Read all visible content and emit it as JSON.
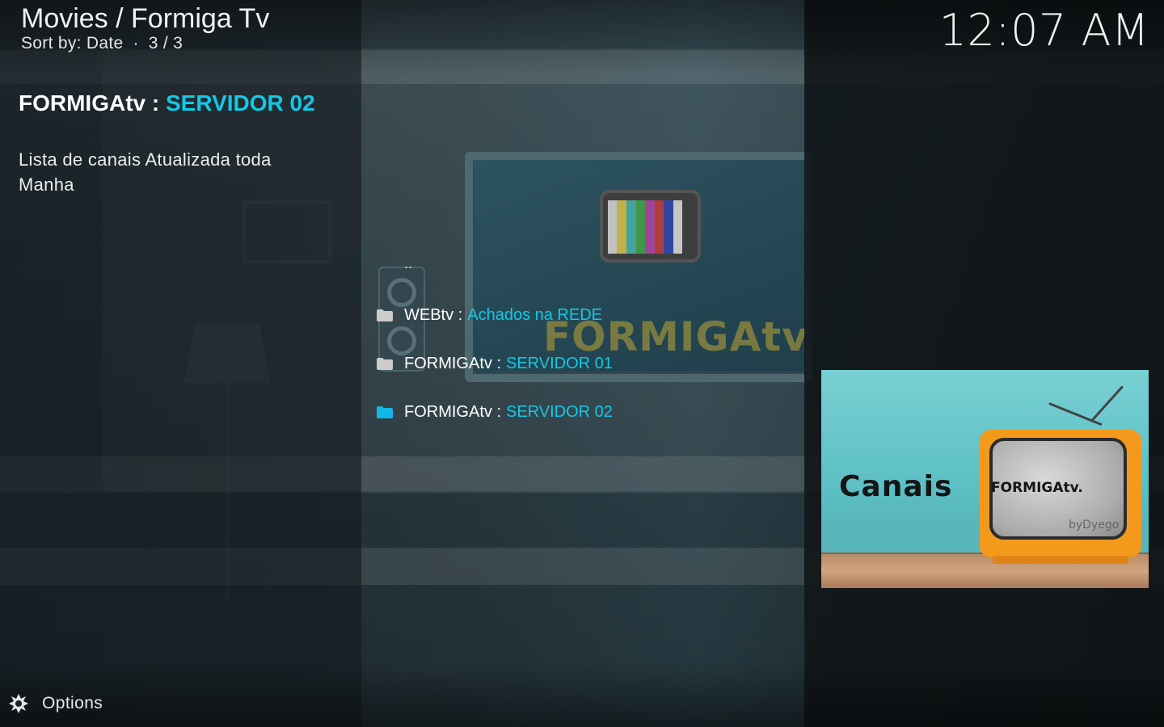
{
  "header": {
    "breadcrumb": "Movies / Formiga Tv",
    "sort_label": "Sort by: Date",
    "position": "3 / 3",
    "clock": "12:07 AM"
  },
  "info": {
    "title_prefix": "FORMIGAtv :",
    "title_suffix": "SERVIDOR 02",
    "description": "Lista de canais Atualizada toda Manha"
  },
  "list": {
    "parent": "..",
    "items": [
      {
        "prefix": "WEBtv :",
        "suffix": "Achados na REDE",
        "icon": "folder-icon",
        "selected": false
      },
      {
        "prefix": "FORMIGAtv :",
        "suffix": "SERVIDOR 01",
        "icon": "folder-icon",
        "selected": false
      },
      {
        "prefix": "FORMIGAtv :",
        "suffix": "SERVIDOR 02",
        "icon": "folder-icon",
        "selected": true
      }
    ]
  },
  "background": {
    "watermark": "FORMIGAtv"
  },
  "thumbnail": {
    "canais": "Canais",
    "tv_label": "FORMIGAtv.",
    "by_label": "byDyego"
  },
  "footer": {
    "options_label": "Options",
    "options_icon": "options-gear-icon"
  },
  "colors": {
    "accent": "#12c9e6",
    "folder_default": "#cccccc",
    "folder_selected": "#12b7e6"
  }
}
